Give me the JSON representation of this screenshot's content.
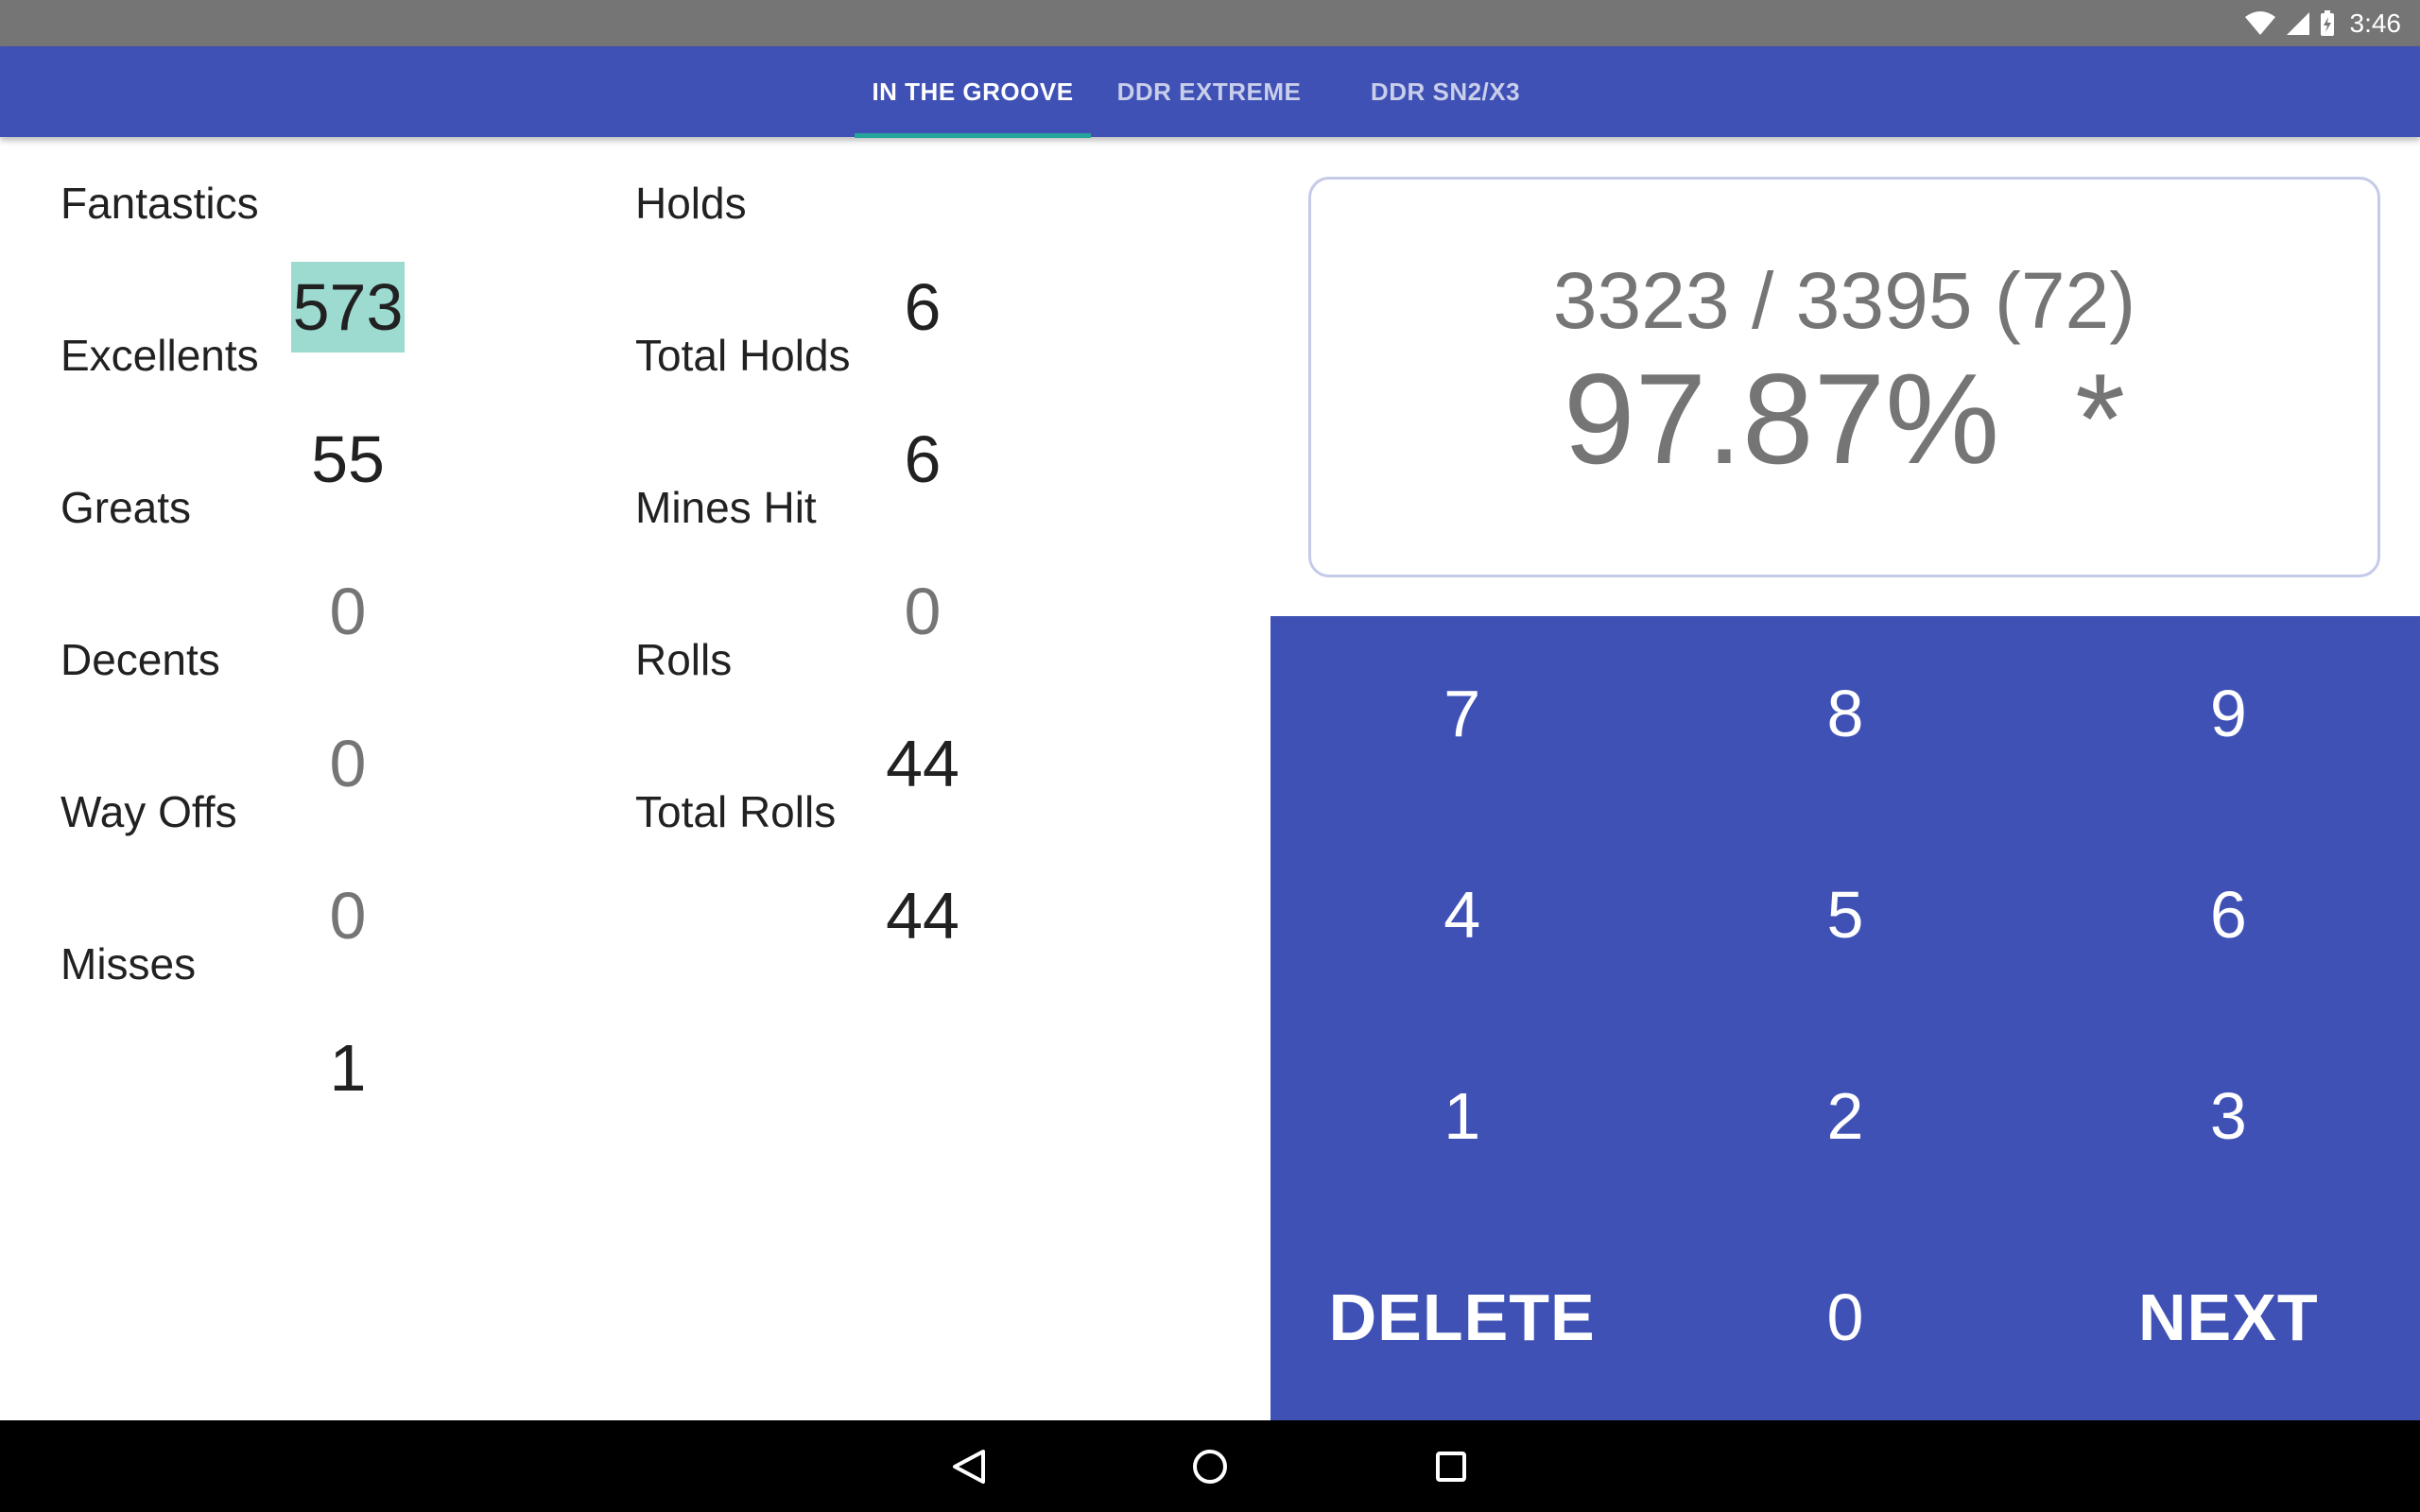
{
  "status_bar": {
    "time": "3:46",
    "icons": [
      "wifi-icon",
      "cell-signal-icon",
      "battery-charging-icon"
    ]
  },
  "tabs": [
    {
      "label": "IN THE GROOVE",
      "active": true
    },
    {
      "label": "DDR EXTREME",
      "active": false
    },
    {
      "label": "DDR SN2/X3",
      "active": false
    }
  ],
  "counters_left": [
    {
      "label": "Fantastics",
      "value": "573",
      "selected": true
    },
    {
      "label": "Excellents",
      "value": "55"
    },
    {
      "label": "Greats",
      "value": "0"
    },
    {
      "label": "Decents",
      "value": "0"
    },
    {
      "label": "Way Offs",
      "value": "0"
    },
    {
      "label": "Misses",
      "value": "1"
    }
  ],
  "counters_right": [
    {
      "label": "Holds",
      "value": "6"
    },
    {
      "label": "Total Holds",
      "value": "6"
    },
    {
      "label": "Mines Hit",
      "value": "0"
    },
    {
      "label": "Rolls",
      "value": "44"
    },
    {
      "label": "Total Rolls",
      "value": "44"
    }
  ],
  "score": {
    "points": "3323 / 3395 (72)",
    "percent": "97.87%",
    "mark": "*"
  },
  "keypad": {
    "keys": [
      "7",
      "8",
      "9",
      "4",
      "5",
      "6",
      "1",
      "2",
      "3",
      "DELETE",
      "0",
      "NEXT"
    ]
  },
  "colors": {
    "primary": "#3f51b5",
    "accent": "#26a69a",
    "selection": "#9ddbd1",
    "status_bar": "#757575"
  }
}
